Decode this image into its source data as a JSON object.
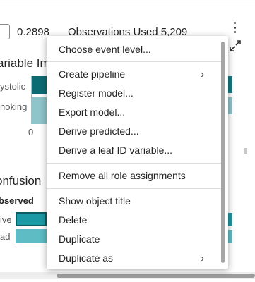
{
  "stats": {
    "value": "0.2898",
    "observations_label": "Observations Used",
    "observations_value": "5,209"
  },
  "variable_importance": {
    "title": "ariable Im",
    "labels": [
      "ystolic",
      "noking"
    ],
    "axis_tick": "0",
    "colors": [
      "#0d6b73",
      "#8ec5cb"
    ]
  },
  "confusion": {
    "title": "onfusion",
    "observed_label": "bserved",
    "row_labels": [
      "ive",
      "ad"
    ],
    "colors": [
      "#1a9aa5",
      "#5dbcc4"
    ]
  },
  "menu": {
    "items": [
      {
        "label": "Choose event level...",
        "submenu": false
      },
      {
        "label": "Create pipeline",
        "submenu": true
      },
      {
        "label": "Register model...",
        "submenu": false
      },
      {
        "label": "Export model...",
        "submenu": false
      },
      {
        "label": "Derive predicted...",
        "submenu": false
      },
      {
        "label": "Derive a leaf ID variable...",
        "submenu": false
      },
      {
        "label": "Remove all role assignments",
        "submenu": false
      },
      {
        "label": "Show object title",
        "submenu": false
      },
      {
        "label": "Delete",
        "submenu": false
      },
      {
        "label": "Duplicate",
        "submenu": false
      },
      {
        "label": "Duplicate as",
        "submenu": true
      }
    ],
    "chevron_glyph": "›"
  },
  "icons": {
    "kebab": "more-vertical-icon",
    "expand": "maximize-icon"
  }
}
